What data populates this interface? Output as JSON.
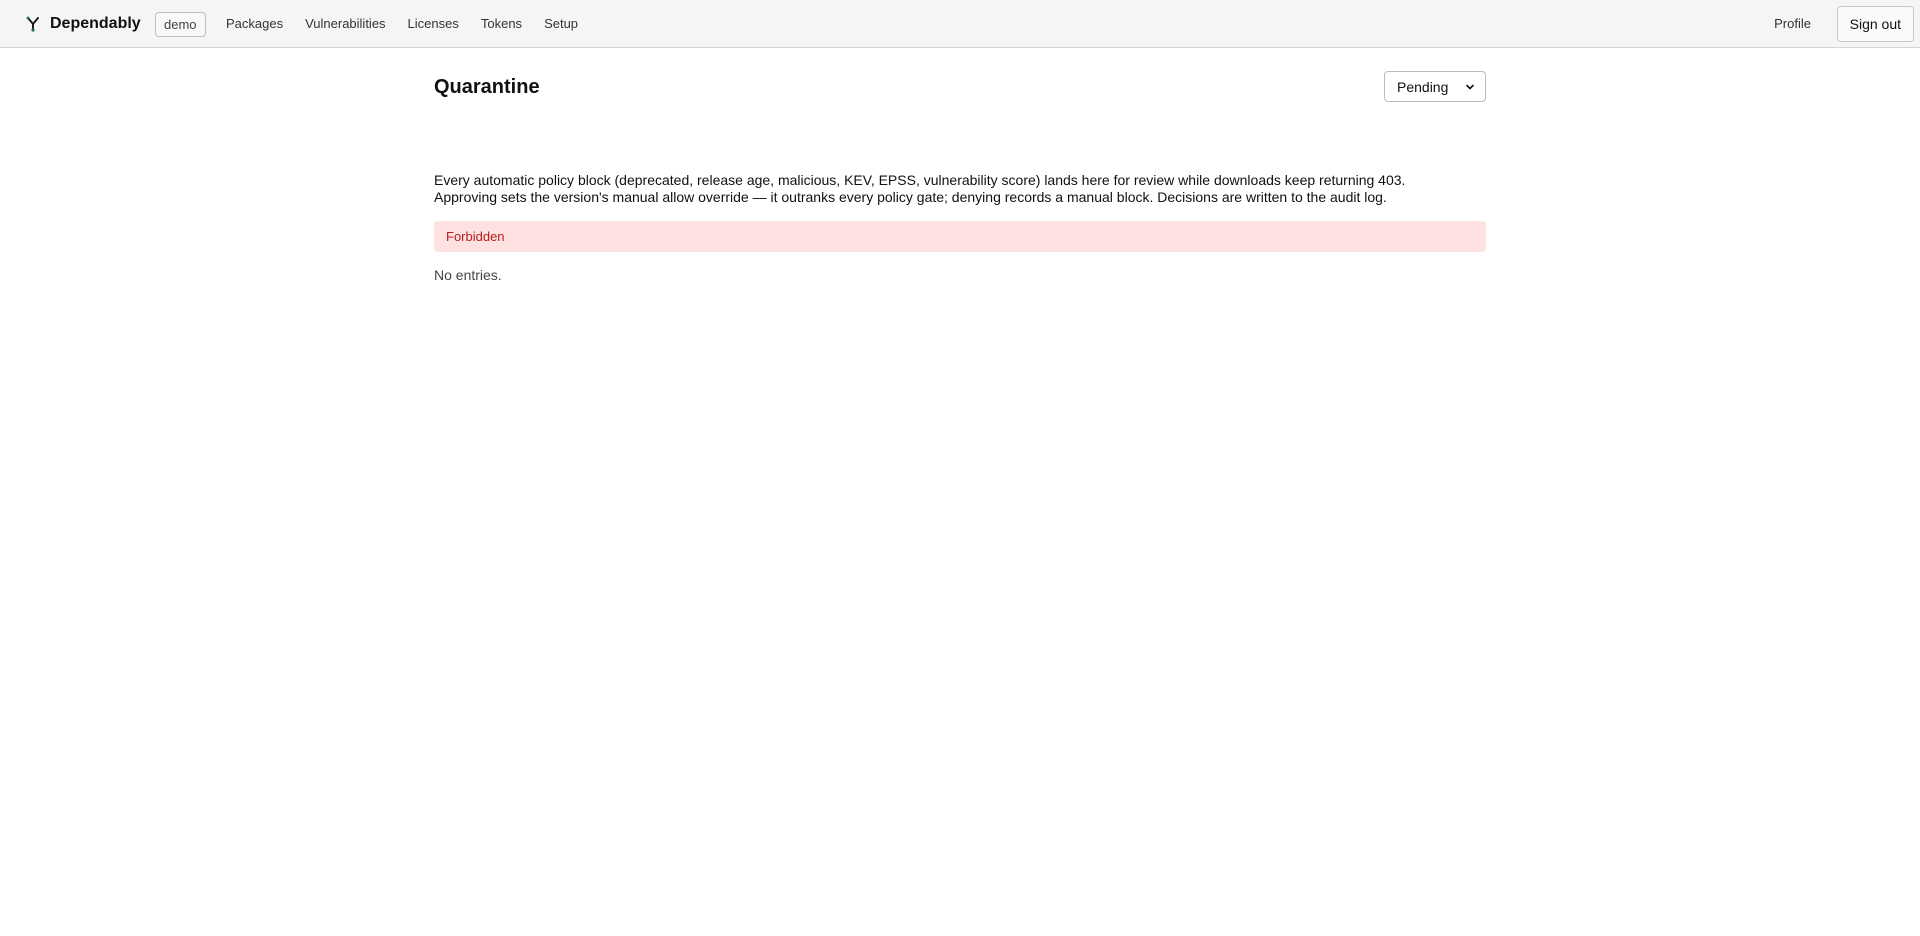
{
  "app": {
    "brand_name": "Dependably",
    "brand_icon": "dependency-branch-icon",
    "org_badge": "demo"
  },
  "nav": {
    "items": [
      {
        "label": "Packages"
      },
      {
        "label": "Vulnerabilities"
      },
      {
        "label": "Licenses"
      },
      {
        "label": "Tokens"
      },
      {
        "label": "Setup"
      }
    ],
    "profile_label": "Profile",
    "signout_label": "Sign out"
  },
  "page": {
    "title": "Quarantine",
    "status_filter": {
      "selected": "Pending",
      "icon": "chevron-down-icon"
    },
    "description_line1": "Every automatic policy block (deprecated, release age, malicious, KEV, EPSS, vulnerability score) lands here for review while downloads keep returning 403.",
    "description_line2": "Approving sets the version's manual allow override — it outranks every policy gate; denying records a manual block. Decisions are written to the audit log.",
    "error_message": "Forbidden",
    "empty_message": "No entries."
  },
  "colors": {
    "topbar_bg": "#f5f5f5",
    "error_bg": "#fee2e2",
    "error_text": "#b91c1c",
    "logo_accent": "#1f6f4a"
  }
}
